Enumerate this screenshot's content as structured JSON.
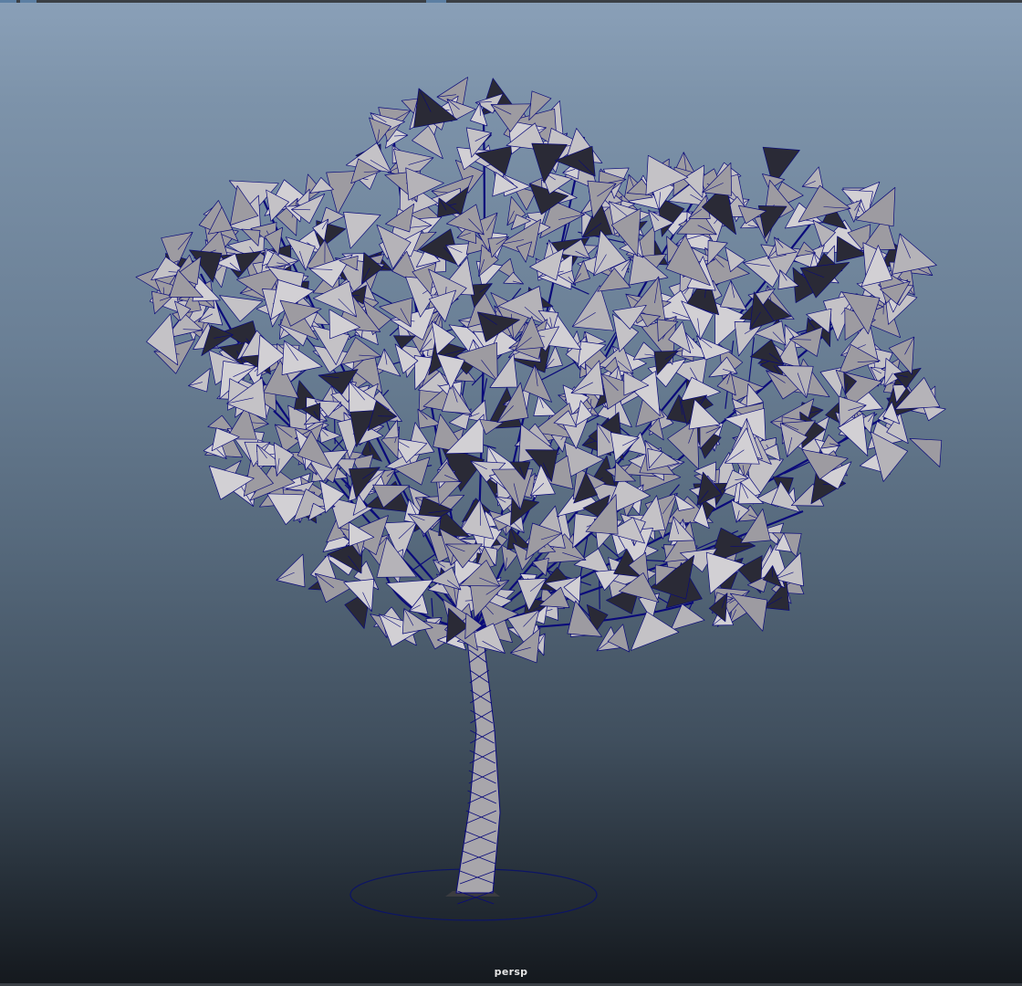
{
  "viewport": {
    "camera_label": "persp",
    "colors": {
      "wire": "#0a0a7a",
      "leaf_light": "#c4c2c6",
      "leaf_mid": "#9d9ba1",
      "leaf_dark": "#2a2a36",
      "trunk": "#a8a6ab",
      "ground_ring": "#0c1466"
    }
  }
}
